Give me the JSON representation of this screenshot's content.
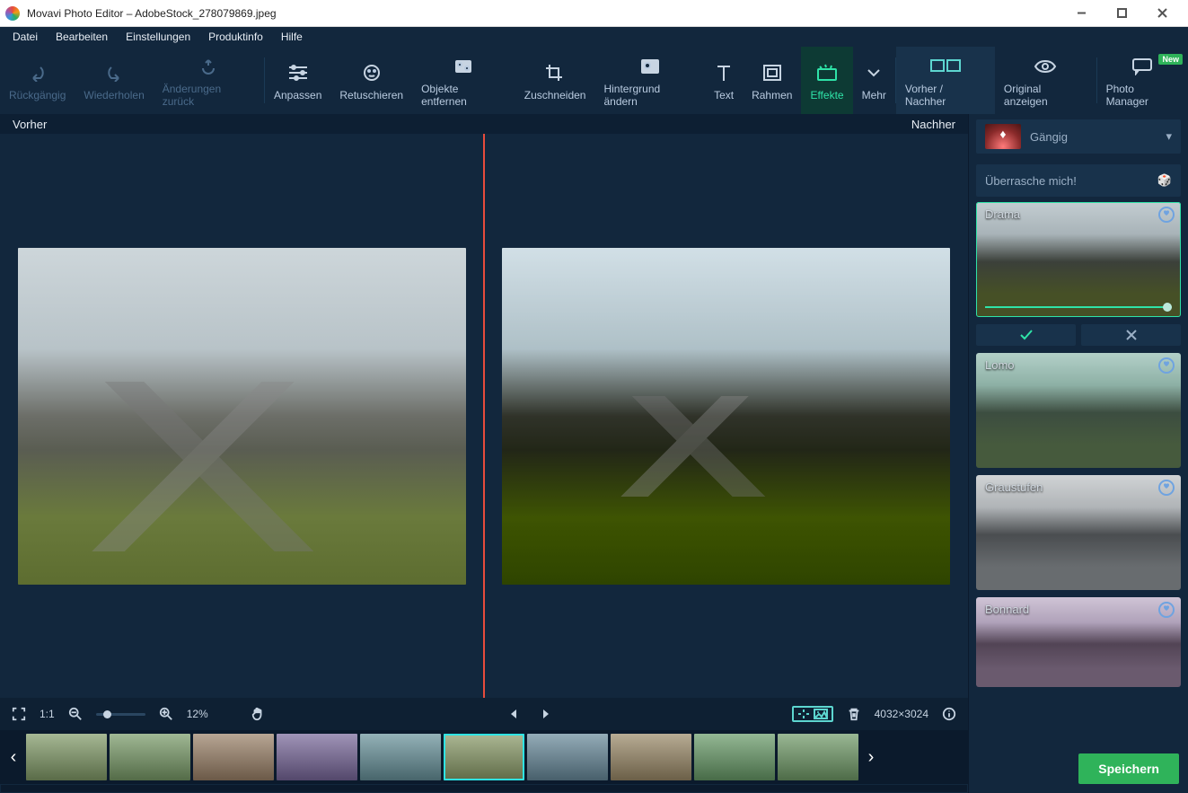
{
  "window": {
    "title": "Movavi Photo Editor – AdobeStock_278079869.jpeg"
  },
  "menu": {
    "file": "Datei",
    "edit": "Bearbeiten",
    "settings": "Einstellungen",
    "product": "Produktinfo",
    "help": "Hilfe"
  },
  "toolbar": {
    "undo": "Rückgängig",
    "redo": "Wiederholen",
    "revert": "Änderungen zurück",
    "adjust": "Anpassen",
    "retouch": "Retuschieren",
    "remove_objects": "Objekte entfernen",
    "crop": "Zuschneiden",
    "change_bg": "Hintergrund ändern",
    "text": "Text",
    "frames": "Rahmen",
    "effects": "Effekte",
    "more": "Mehr",
    "before_after": "Vorher / Nachher",
    "show_original": "Original anzeigen",
    "photo_manager": "Photo Manager",
    "new_badge": "New"
  },
  "compare": {
    "before": "Vorher",
    "after": "Nachher"
  },
  "bottom": {
    "one_to_one": "1:1",
    "zoom_percent": "12%",
    "image_dims": "4032×3024"
  },
  "effects_panel": {
    "category": "Gängig",
    "surprise": "Überrasche mich!",
    "items": [
      {
        "id": "drama",
        "name": "Drama",
        "selected": true
      },
      {
        "id": "lomo",
        "name": "Lomo",
        "selected": false
      },
      {
        "id": "gray",
        "name": "Graustufen",
        "selected": false
      },
      {
        "id": "bonn",
        "name": "Bonnard",
        "selected": false
      }
    ]
  },
  "save": {
    "label": "Speichern"
  },
  "filmstrip": {
    "count": 10,
    "selected_index": 5
  }
}
